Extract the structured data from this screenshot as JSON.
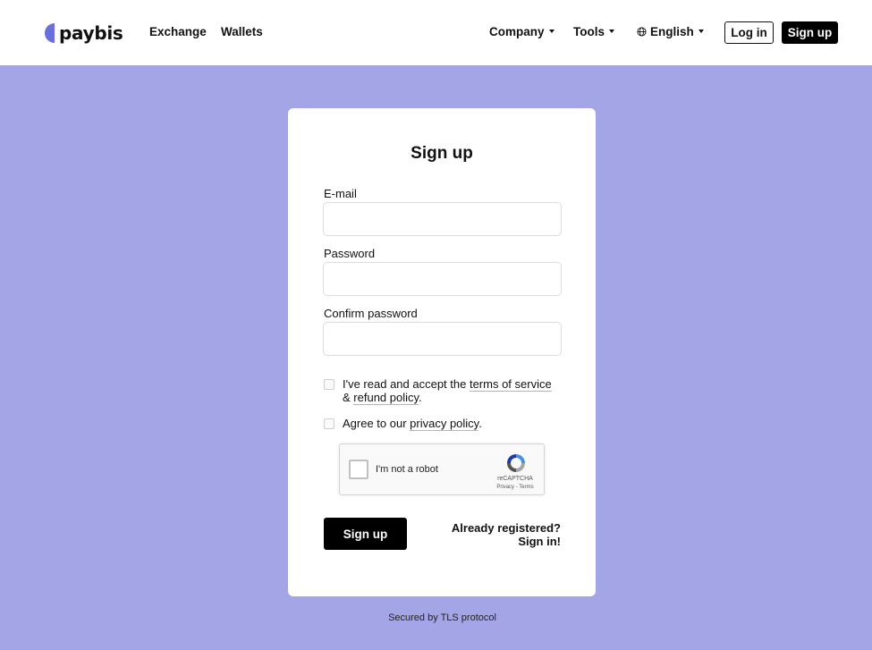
{
  "brand": {
    "name": "paybis",
    "mark_color": "#6a6fdc"
  },
  "nav": {
    "exchange": "Exchange",
    "wallets": "Wallets",
    "company": "Company",
    "tools": "Tools",
    "language": "English",
    "login": "Log in",
    "signup": "Sign up"
  },
  "form": {
    "title": "Sign up",
    "email_label": "E-mail",
    "email_value": "",
    "password_label": "Password",
    "password_value": "",
    "confirm_label": "Confirm password",
    "confirm_value": "",
    "terms_prefix": "I've read and accept the ",
    "terms_link": "terms of service",
    "terms_amp": "& ",
    "refund_link": "refund policy",
    "terms_suffix": ".",
    "privacy_prefix": "Agree to our ",
    "privacy_link": "privacy policy",
    "privacy_suffix": ".",
    "submit": "Sign up",
    "already_registered": "Already registered?",
    "sign_in": "Sign in!"
  },
  "recaptcha": {
    "label": "I'm not a robot",
    "brand": "reCAPTCHA",
    "links": "Privacy - Terms"
  },
  "footer": {
    "note": "Secured by TLS protocol"
  },
  "colors": {
    "background": "#a4a5e6",
    "accent": "#000000"
  }
}
